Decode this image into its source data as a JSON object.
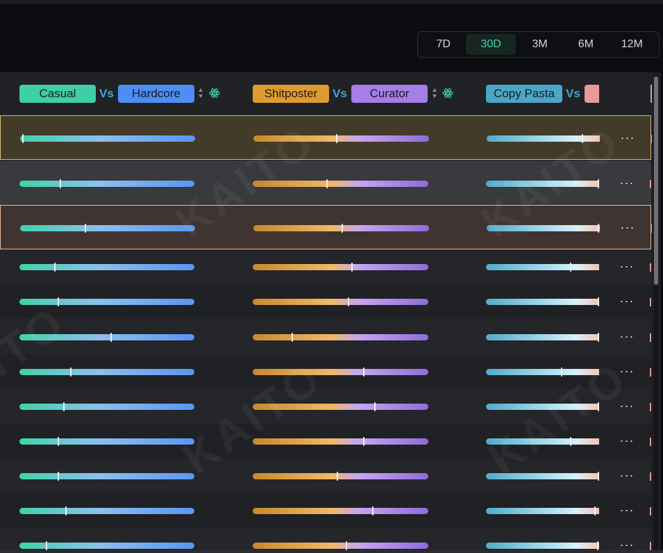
{
  "periods": {
    "options": [
      "7D",
      "30D",
      "3M",
      "6M",
      "12M"
    ],
    "active": "30D",
    "colors": {
      "active_bg": "#162620",
      "active_text": "#3fd6b0"
    }
  },
  "columns": [
    {
      "left": "Casual",
      "right": "Hardcore",
      "vs": "Vs",
      "left_color": "#3ecfa8",
      "right_color": "#4d8ef5",
      "icons": [
        "sort-icon",
        "atom-icon"
      ]
    },
    {
      "left": "Shitposter",
      "right": "Curator",
      "vs": "Vs",
      "left_color": "#e09b30",
      "right_color": "#a57ee6",
      "icons": [
        "sort-icon",
        "atom-icon"
      ]
    },
    {
      "left": "Copy Pasta",
      "right": "",
      "vs": "Vs",
      "left_color": "#4aa7c8",
      "right_color": "#e89a9a"
    }
  ],
  "rows": [
    {
      "values": [
        0.01,
        0.47,
        0.84
      ],
      "highlight": "gold"
    },
    {
      "values": [
        0.23,
        0.42,
        1.0
      ],
      "highlight": "grey"
    },
    {
      "values": [
        0.37,
        0.5,
        0.98
      ],
      "highlight": "rose"
    },
    {
      "values": [
        0.2,
        0.56,
        0.74
      ],
      "highlight": ""
    },
    {
      "values": [
        0.22,
        0.54,
        1.0
      ],
      "highlight": ""
    },
    {
      "values": [
        0.52,
        0.22,
        1.0
      ],
      "highlight": ""
    },
    {
      "values": [
        0.29,
        0.63,
        0.66
      ],
      "highlight": ""
    },
    {
      "values": [
        0.25,
        0.69,
        1.0
      ],
      "highlight": ""
    },
    {
      "values": [
        0.22,
        0.63,
        0.74
      ],
      "highlight": ""
    },
    {
      "values": [
        0.22,
        0.48,
        1.0
      ],
      "highlight": ""
    },
    {
      "values": [
        0.26,
        0.68,
        0.96
      ],
      "highlight": ""
    },
    {
      "values": [
        0.15,
        0.53,
        0.98
      ],
      "highlight": ""
    }
  ],
  "row_action_icon": "more-horizontal-icon",
  "watermark": "KAITO"
}
